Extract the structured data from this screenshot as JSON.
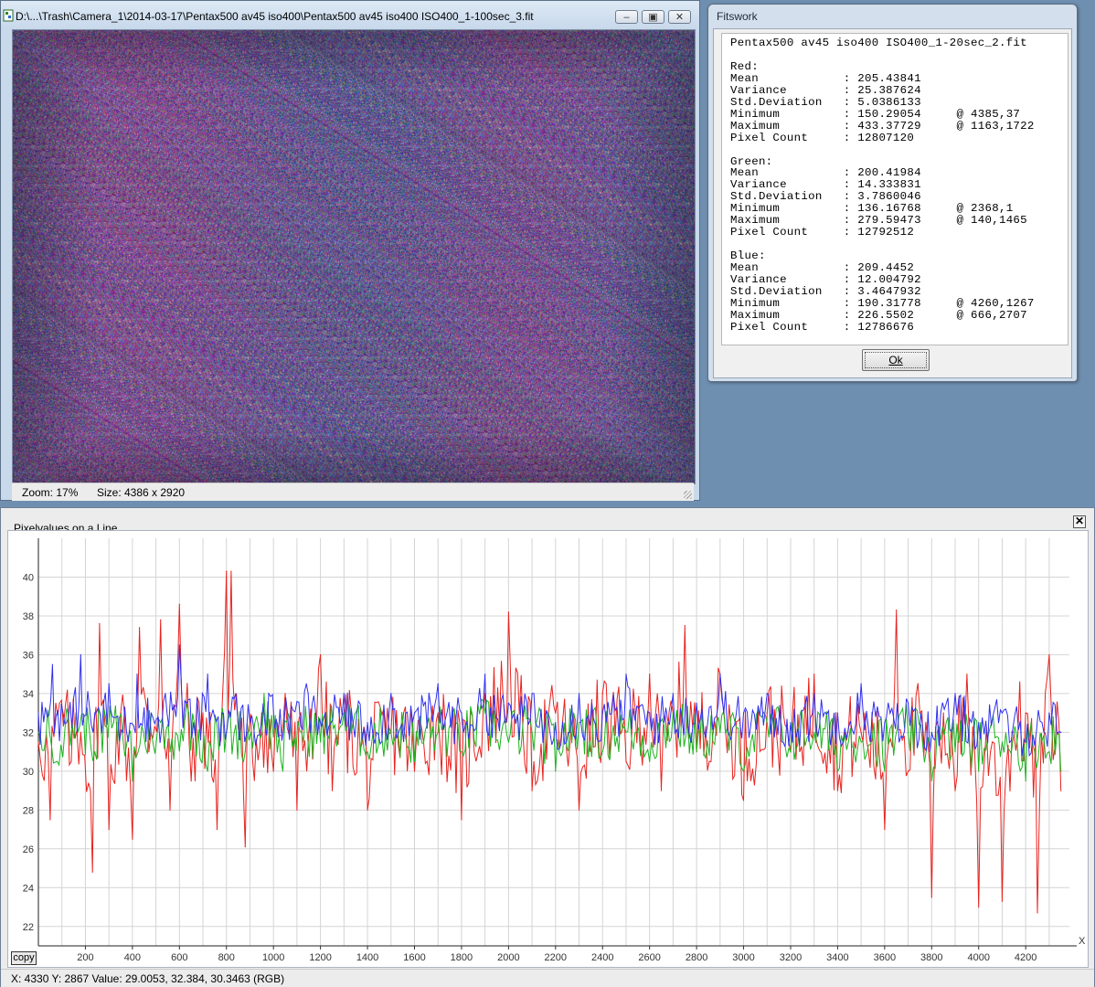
{
  "image_window": {
    "title": "D:\\...\\Trash\\Camera_1\\2014-03-17\\Pentax500 av45 iso400\\Pentax500 av45 iso400 ISO400_1-100sec_3.fit",
    "minimize_glyph": "‒",
    "maximize_glyph": "▣",
    "close_glyph": "✕",
    "zoom": "Zoom: 17%",
    "size": "Size: 4386 x 2920"
  },
  "dialog": {
    "title": "Fitswork",
    "file": "Pentax500 av45 iso400 ISO400_1-20sec_2.fit",
    "channels": [
      {
        "name": "Red:",
        "mean": "205.43841",
        "variance": "25.387624",
        "std": "5.0386133",
        "min": "150.29054",
        "min_at": "@ 4385,37",
        "max": "433.37729",
        "max_at": "@ 1163,1722",
        "count": "12807120"
      },
      {
        "name": "Green:",
        "mean": "200.41984",
        "variance": "14.333831",
        "std": "3.7860046",
        "min": "136.16768",
        "min_at": "@ 2368,1",
        "max": "279.59473",
        "max_at": "@ 140,1465",
        "count": "12792512"
      },
      {
        "name": "Blue:",
        "mean": "209.4452",
        "variance": "12.004792",
        "std": "3.4647932",
        "min": "190.31778",
        "min_at": "@ 4260,1267",
        "max": "226.5502",
        "max_at": "@ 666,2707",
        "count": "12786676"
      }
    ],
    "labels": {
      "mean": "Mean",
      "variance": "Variance",
      "std": "Std.Deviation",
      "min": "Minimum",
      "max": "Maximum",
      "count": "Pixel Count"
    },
    "ok_label": "Ok"
  },
  "plot_window": {
    "title": "Pixelvalues on a Line",
    "close_glyph": "✕",
    "copy_label": "copy",
    "status": "X: 4330  Y: 2867  Value: 29.0053, 32.384, 30.3463 (RGB)"
  },
  "colors": {
    "red": "#e8231f",
    "green": "#1db31d",
    "blue": "#3030f0",
    "grid": "#d4d4d4"
  },
  "chart_data": {
    "type": "line",
    "xlabel": "X",
    "xlim": [
      0,
      4386
    ],
    "ylim": [
      21,
      42
    ],
    "x_ticks": [
      200,
      400,
      600,
      800,
      1000,
      1200,
      1400,
      1600,
      1800,
      2000,
      2200,
      2400,
      2600,
      2800,
      3000,
      3200,
      3400,
      3600,
      3800,
      4000,
      4200
    ],
    "y_ticks": [
      22,
      24,
      26,
      28,
      30,
      32,
      34,
      36,
      38,
      40
    ],
    "series": [
      {
        "color": "red",
        "x": [
          0,
          50,
          90,
          140,
          180,
          230,
          260,
          300,
          350,
          400,
          430,
          470,
          520,
          560,
          600,
          650,
          700,
          760,
          800,
          820,
          880,
          950,
          1000,
          1050,
          1100,
          1150,
          1200,
          1250,
          1300,
          1400,
          1500,
          1600,
          1700,
          1800,
          1900,
          2000,
          2100,
          2200,
          2300,
          2400,
          2500,
          2600,
          2650,
          2700,
          2750,
          2800,
          2900,
          3000,
          3100,
          3200,
          3300,
          3400,
          3500,
          3600,
          3650,
          3700,
          3750,
          3800,
          3850,
          3900,
          3950,
          4000,
          4050,
          4100,
          4150,
          4200,
          4250,
          4300,
          4350
        ],
        "y": [
          31.5,
          27.5,
          33.5,
          30.5,
          32,
          24.8,
          37.6,
          27,
          33,
          26.5,
          37.4,
          31,
          37.8,
          28,
          38.6,
          29.5,
          33,
          27,
          40.3,
          40.3,
          26.1,
          33,
          30,
          34,
          28,
          32,
          36,
          29,
          33,
          28,
          32,
          30,
          33,
          27.5,
          34,
          38.2,
          29,
          33,
          28,
          34,
          30.5,
          35,
          29,
          33,
          37.5,
          31,
          35,
          28.5,
          33,
          31,
          35,
          29,
          32,
          27,
          38.3,
          30,
          33,
          23.5,
          33,
          29,
          35,
          23,
          31,
          23.3,
          32,
          33,
          22.7,
          36,
          29
        ]
      },
      {
        "color": "green",
        "x": [
          0,
          80,
          160,
          240,
          320,
          400,
          480,
          560,
          640,
          720,
          800,
          880,
          960,
          1040,
          1120,
          1200,
          1300,
          1400,
          1500,
          1600,
          1700,
          1800,
          1900,
          2000,
          2100,
          2200,
          2300,
          2400,
          2500,
          2600,
          2700,
          2800,
          2900,
          3000,
          3100,
          3200,
          3300,
          3400,
          3500,
          3600,
          3700,
          3800,
          3900,
          4000,
          4100,
          4200,
          4300,
          4350
        ],
        "y": [
          32,
          30.5,
          33,
          31,
          32.5,
          29.5,
          32,
          31,
          33,
          30,
          32,
          31,
          34,
          30,
          32,
          31.5,
          33,
          31,
          32,
          30.5,
          32,
          31,
          33,
          31.5,
          32,
          30,
          32.5,
          31,
          32,
          30.5,
          33,
          31,
          32,
          30,
          32.5,
          31,
          32,
          30,
          31.5,
          30,
          32,
          29.5,
          31,
          30,
          31.5,
          29.5,
          31,
          30
        ]
      },
      {
        "color": "blue",
        "x": [
          0,
          60,
          120,
          180,
          240,
          300,
          360,
          420,
          480,
          540,
          600,
          660,
          720,
          780,
          840,
          900,
          980,
          1060,
          1140,
          1220,
          1300,
          1400,
          1500,
          1600,
          1700,
          1800,
          1900,
          2000,
          2100,
          2200,
          2300,
          2400,
          2500,
          2600,
          2700,
          2800,
          2900,
          3000,
          3100,
          3200,
          3300,
          3400,
          3500,
          3600,
          3700,
          3800,
          3900,
          4000,
          4100,
          4200,
          4300,
          4350
        ],
        "y": [
          33,
          35.5,
          32.5,
          36,
          33,
          34.5,
          32,
          35,
          33,
          34,
          36.5,
          32.5,
          35,
          33,
          34,
          32.5,
          34,
          33,
          34.5,
          33,
          34,
          32.5,
          34,
          33,
          34.5,
          33,
          35,
          33.5,
          34,
          32.5,
          34,
          33,
          35,
          33,
          34,
          33.5,
          35,
          33,
          34,
          32.5,
          34,
          33,
          34.5,
          32.5,
          33.5,
          32,
          34,
          32.5,
          33,
          31.5,
          33,
          32
        ]
      }
    ]
  }
}
